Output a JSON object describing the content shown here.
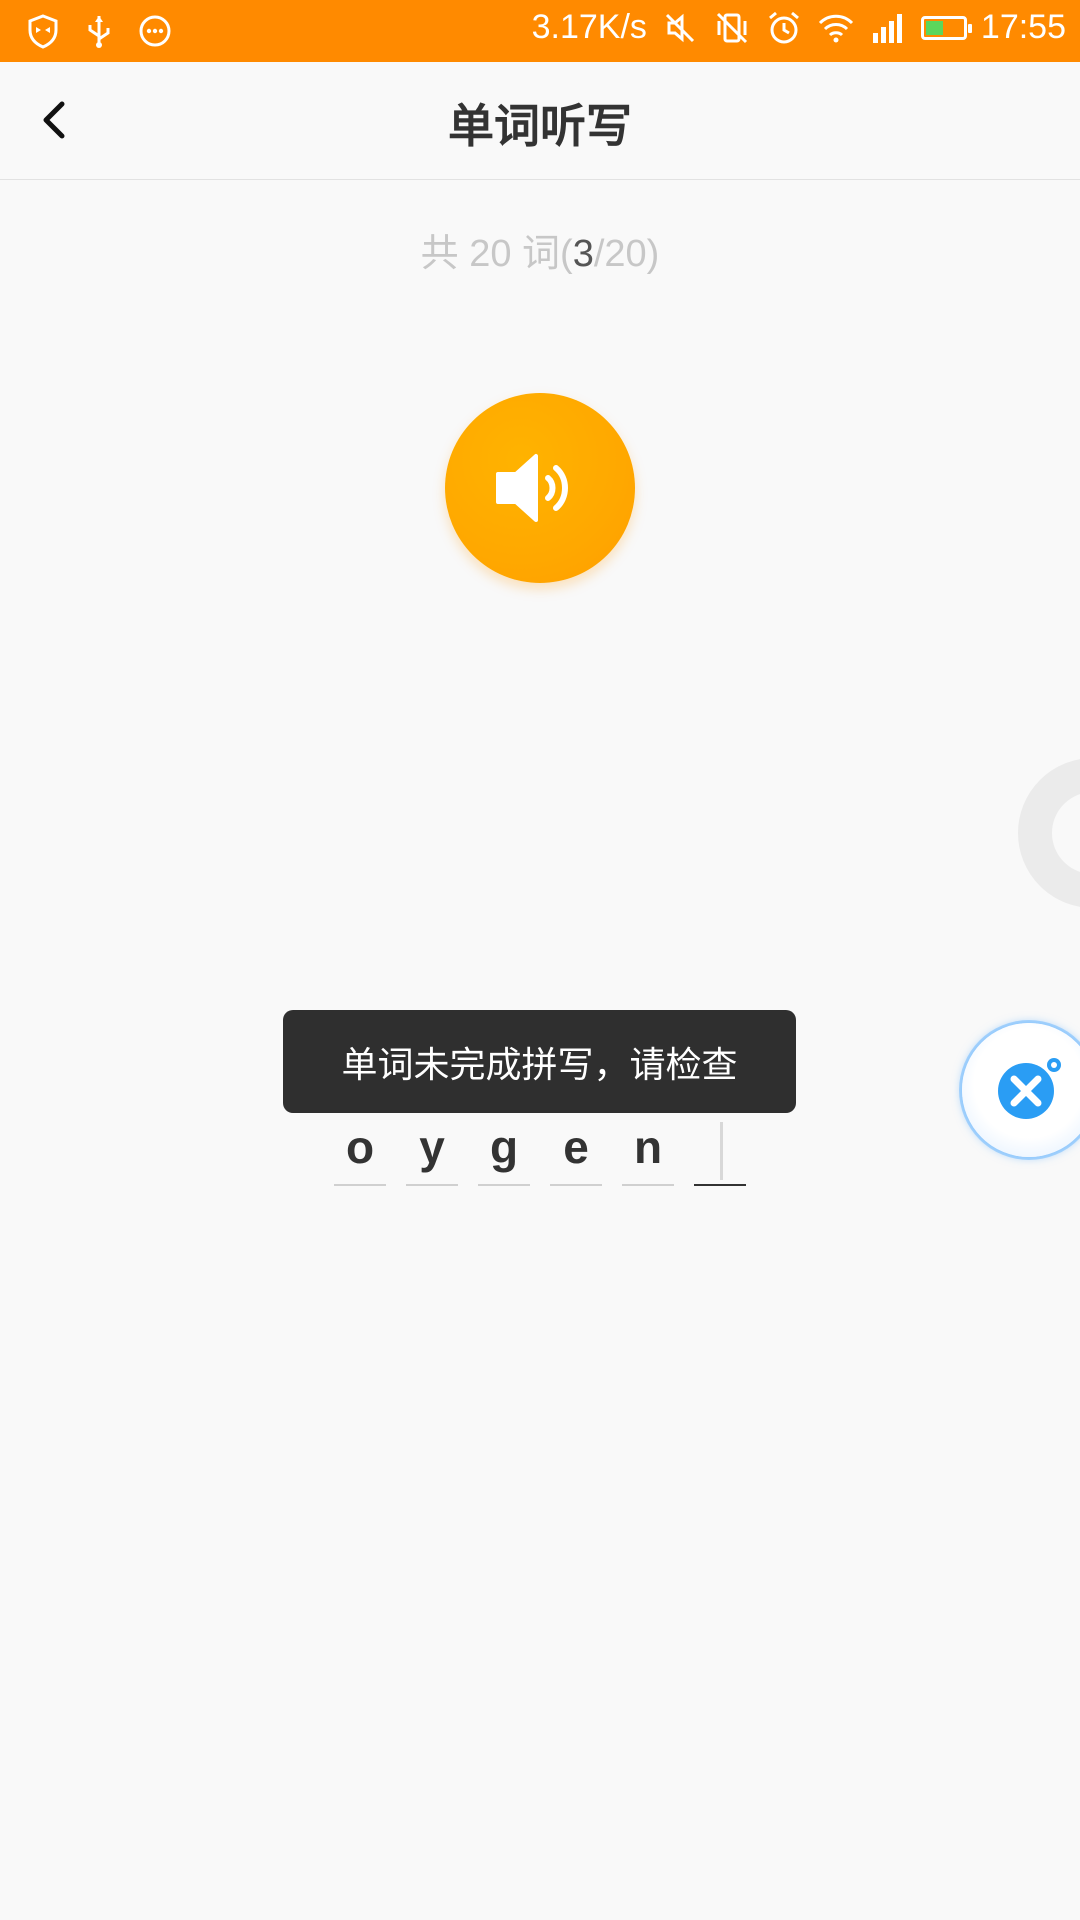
{
  "status_bar": {
    "net_speed": "3.17K/s",
    "time": "17:55",
    "battery_fraction": 0.45,
    "left_icons": [
      "shield-icon",
      "usb-icon",
      "more-icon"
    ],
    "right_icons": [
      "mute-icon",
      "vibrate-off-icon",
      "alarm-icon",
      "wifi-icon",
      "signal-icon",
      "battery-icon"
    ]
  },
  "header": {
    "title": "单词听写",
    "back_icon": "chevron-left-icon"
  },
  "progress": {
    "prefix": "共 20 词(",
    "current": "3",
    "suffix": "/20)"
  },
  "speaker": {
    "icon": "speaker-icon",
    "color": "#ffa800"
  },
  "toast": {
    "message": "单词未完成拼写，请检查"
  },
  "spelling": {
    "letters": [
      "o",
      "y",
      "g",
      "e",
      "n",
      ""
    ]
  },
  "colors": {
    "status_bar": "#ff8a00",
    "background": "#f9f9f9",
    "accent": "#ffa800",
    "toast_bg": "#2f2f2f",
    "float_button_icon": "#2a9df4"
  }
}
